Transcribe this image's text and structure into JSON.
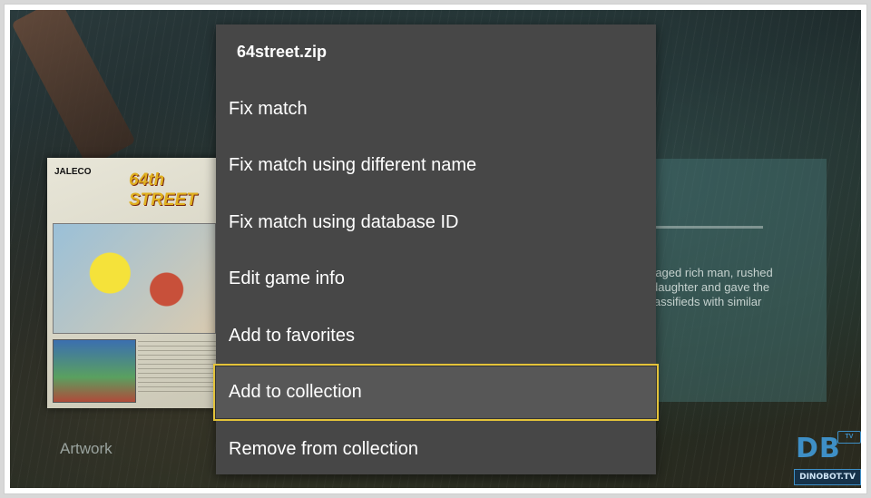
{
  "background": {
    "cover": {
      "publisher": "JALECO",
      "title": "64th STREET"
    },
    "artwork_label": "Artwork",
    "description_lines": [
      "-aged rich man, rushed",
      "daughter and gave the",
      "lassifieds with similar"
    ]
  },
  "menu": {
    "title": "64street.zip",
    "items": [
      {
        "label": "Fix match"
      },
      {
        "label": "Fix match using different name"
      },
      {
        "label": "Fix match using database ID"
      },
      {
        "label": "Edit game info"
      },
      {
        "label": "Add to favorites"
      },
      {
        "label": "Add to collection",
        "focused": true
      },
      {
        "label": "Remove from collection"
      }
    ],
    "focus_color": "#e3c33a"
  },
  "watermark": {
    "logo_text": "DB",
    "logo_badge": "TV",
    "logo_sub": "DINOBOT.TV"
  }
}
